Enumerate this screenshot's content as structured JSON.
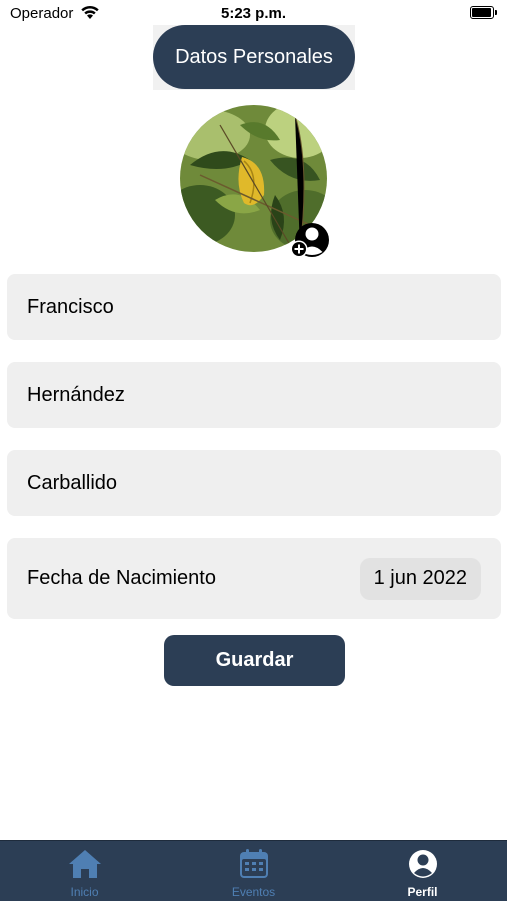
{
  "status_bar": {
    "carrier": "Operador",
    "time": "5:23 p.m."
  },
  "header": {
    "title": "Datos Personales"
  },
  "avatar": {
    "photo": "leaf-photo",
    "action_icon": "add-person-icon"
  },
  "form": {
    "first_name": "Francisco",
    "last_name_1": "Hernández",
    "last_name_2": "Carballido",
    "birthdate_label": "Fecha de Nacimiento",
    "birthdate_value": "1 jun 2022"
  },
  "save_button": {
    "label": "Guardar"
  },
  "tab_bar": {
    "items": [
      {
        "label": "Inicio",
        "icon": "home-icon",
        "active": false
      },
      {
        "label": "Eventos",
        "icon": "calendar-icon",
        "active": false
      },
      {
        "label": "Perfil",
        "icon": "profile-icon",
        "active": true
      }
    ]
  },
  "colors": {
    "primary": "#2c3e55",
    "field_bg": "#efefef",
    "tab_inactive": "#4f7fb3"
  }
}
